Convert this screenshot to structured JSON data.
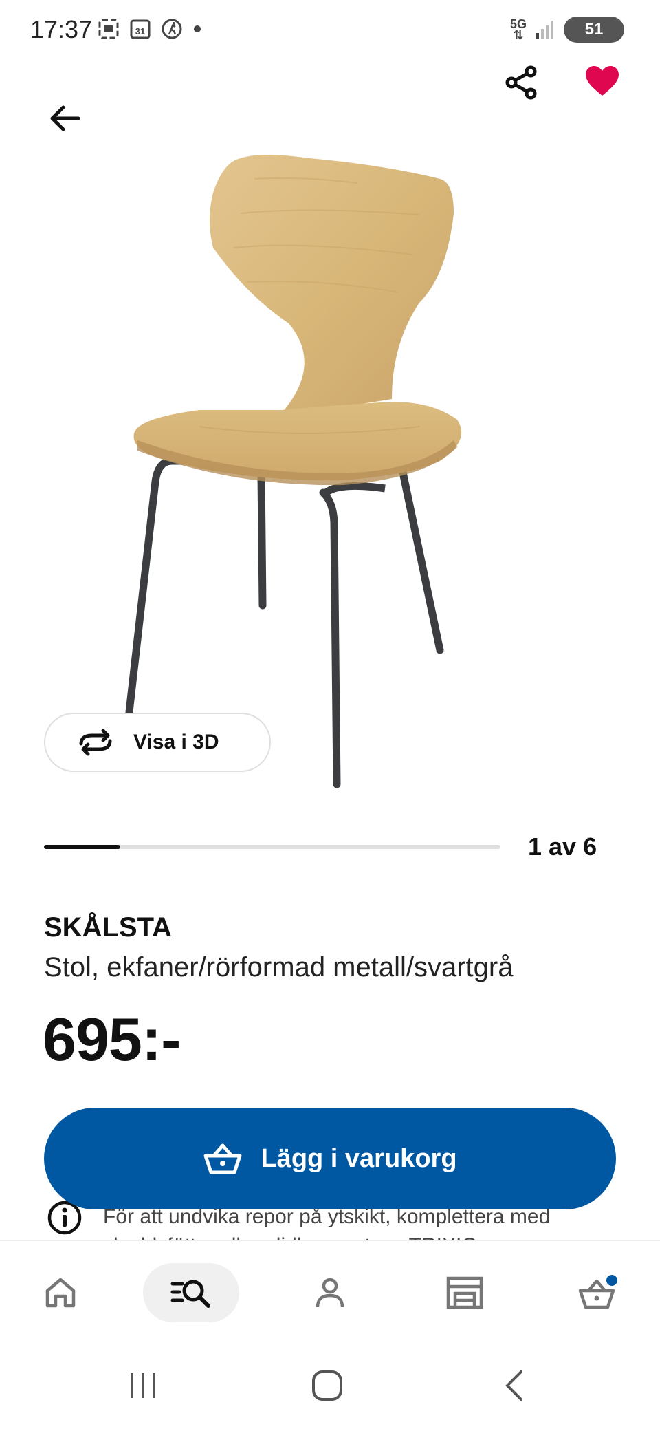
{
  "status_bar": {
    "time": "17:37",
    "battery": "51",
    "network": "5G"
  },
  "header": {
    "back_icon": "arrow-left-icon",
    "share_icon": "share-icon",
    "favorite_icon": "heart-icon",
    "favorite_active": true
  },
  "gallery": {
    "view_3d_label": "Visa i 3D",
    "page_indicator": "1 av 6",
    "progress": 0.167
  },
  "product": {
    "name": "SKÅLSTA",
    "description": "Stol, ekfaner/rörformad metall/svartgrå",
    "price": "695:-"
  },
  "info": {
    "text": "För att undvika repor på ytskikt, komplettera med skyddsfötter eller glidlappar, t.ex. TRIXIG"
  },
  "actions": {
    "add_to_cart_label": "Lägg i varukorg"
  },
  "bottom_nav": {
    "items": [
      "home-icon",
      "search-icon",
      "profile-icon",
      "store-icon",
      "cart-icon"
    ],
    "active": "search-icon",
    "cart_badge": true
  },
  "colors": {
    "brand_blue": "#0058a3",
    "heart_red": "#e00751",
    "text": "#111111"
  }
}
